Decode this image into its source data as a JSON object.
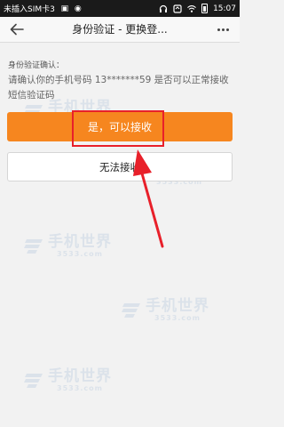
{
  "status_bar": {
    "carrier": "未插入SIM卡3",
    "time": "15:07"
  },
  "app_bar": {
    "title": "身份验证 - 更换登..."
  },
  "verification": {
    "section_label": "身份验证确认：",
    "message": "请确认你的手机号码 13*******59 是否可以正常接收短信验证码",
    "confirm_button": "是，可以接收",
    "cannot_button": "无法接收"
  },
  "watermark": {
    "text": "手机世界",
    "number": "3533.com"
  },
  "colors": {
    "accent": "#f6861f",
    "highlight": "#e8202a"
  },
  "icons": [
    "back-arrow-icon",
    "more-icon",
    "headphone-icon",
    "notification-icon",
    "wifi-icon",
    "battery-icon"
  ]
}
